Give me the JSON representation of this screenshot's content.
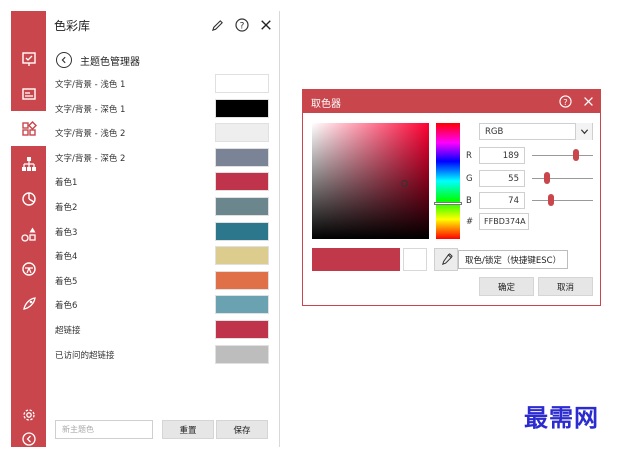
{
  "panel": {
    "title": "色彩库",
    "back_label": "主题色管理器",
    "rows": [
      {
        "label": "文字/背景 - 浅色 1",
        "color": "#ffffff"
      },
      {
        "label": "文字/背景 - 深色 1",
        "color": "#000000"
      },
      {
        "label": "文字/背景 - 浅色 2",
        "color": "#eeeeee"
      },
      {
        "label": "文字/背景 - 深色 2",
        "color": "#7b8496"
      },
      {
        "label": "着色1",
        "color": "#c0344b"
      },
      {
        "label": "着色2",
        "color": "#6b878d"
      },
      {
        "label": "着色3",
        "color": "#2c778c"
      },
      {
        "label": "着色4",
        "color": "#dccd8f"
      },
      {
        "label": "着色5",
        "color": "#e07048"
      },
      {
        "label": "着色6",
        "color": "#6aa2b2"
      },
      {
        "label": "超链接",
        "color": "#c0344b"
      },
      {
        "label": "已访问的超链接",
        "color": "#bdbdbd"
      }
    ],
    "theme_name_placeholder": "新主题色",
    "reset_label": "重置",
    "save_label": "保存"
  },
  "rail": {
    "icons": [
      "presentation-icon",
      "slide-icon",
      "grid-apps-icon",
      "hierarchy-icon",
      "pie-chart-icon",
      "shapes-icon",
      "palette-icon",
      "rocket-icon",
      "settings-icon",
      "back-icon"
    ],
    "active": "grid-apps-icon",
    "accent": "#c8464c"
  },
  "picker": {
    "title": "取色器",
    "mode": "RGB",
    "channels": [
      {
        "name": "R",
        "value": "189",
        "fraction": 0.741
      },
      {
        "name": "G",
        "value": "55",
        "fraction": 0.216
      },
      {
        "name": "B",
        "value": "74",
        "fraction": 0.29
      }
    ],
    "hex_label": "#",
    "hex": "FFBD374A",
    "tooltip": "取色/锁定（快捷键ESC）",
    "ok_label": "确定",
    "cancel_label": "取消",
    "current_color": "#c0384a"
  },
  "watermark": "最需网"
}
